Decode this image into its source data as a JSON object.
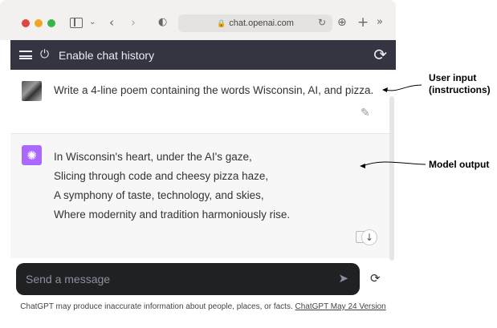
{
  "browser": {
    "url": "chat.openai.com",
    "colors": {
      "close": "#e0443e",
      "minimize": "#f0a622",
      "maximize": "#39b54a"
    }
  },
  "header": {
    "title": "Enable chat history"
  },
  "conversation": {
    "user_message": "Write a 4-line poem containing the words Wisconsin, AI, and pizza.",
    "model_lines": [
      "In Wisconsin's heart, under the AI's gaze,",
      "Slicing through code and cheesy pizza haze,",
      "A symphony of taste, technology, and skies,",
      "Where modernity and tradition harmoniously rise."
    ]
  },
  "composer": {
    "placeholder": "Send a message"
  },
  "footer": {
    "disclaimer": "ChatGPT may produce inaccurate information about people, places, or facts.",
    "version_link": "ChatGPT May 24 Version"
  },
  "annotations": {
    "user_input": "User input (instructions)",
    "model_output": "Model output"
  },
  "icons": [
    "sidebar-icon",
    "chevron-down-icon",
    "back-icon",
    "forward-icon",
    "shield-icon",
    "lock-icon",
    "reload-icon",
    "download-icon",
    "new-tab-icon",
    "more-icon",
    "menu-icon",
    "power-icon",
    "refresh-icon",
    "edit-icon",
    "openai-icon",
    "copy-icon",
    "scroll-down-icon",
    "send-icon",
    "regenerate-icon"
  ]
}
